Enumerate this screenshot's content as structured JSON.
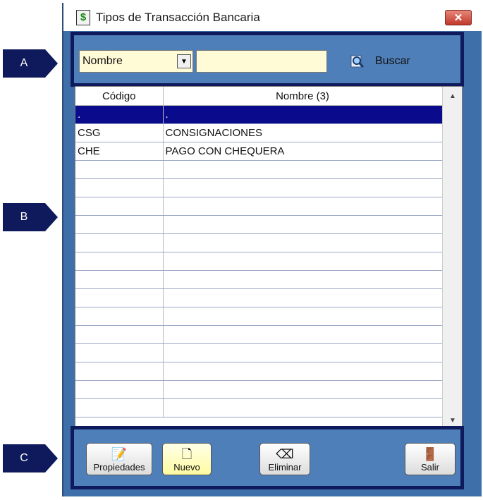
{
  "callouts": {
    "a": "A",
    "b": "B",
    "c": "C"
  },
  "window": {
    "title": "Tipos de Transacción Bancaria",
    "close_label": "✕"
  },
  "search": {
    "field_value": "Nombre",
    "input_value": "",
    "button_label": "Buscar"
  },
  "grid": {
    "columns": [
      "Código",
      "Nombre (3)"
    ],
    "rows": [
      {
        "codigo": ".",
        "nombre": "."
      },
      {
        "codigo": "CSG",
        "nombre": "CONSIGNACIONES"
      },
      {
        "codigo": "CHE",
        "nombre": "PAGO CON CHEQUERA"
      }
    ],
    "selected_row": 0
  },
  "toolbar": {
    "propiedades": "Propiedades",
    "nuevo": "Nuevo",
    "eliminar": "Eliminar",
    "salir": "Salir"
  },
  "colors": {
    "accent_dark": "#0e1a5c",
    "window_bg": "#3f6fa8",
    "selection": "#0a0a8c",
    "input_bg": "#fffbd6"
  }
}
